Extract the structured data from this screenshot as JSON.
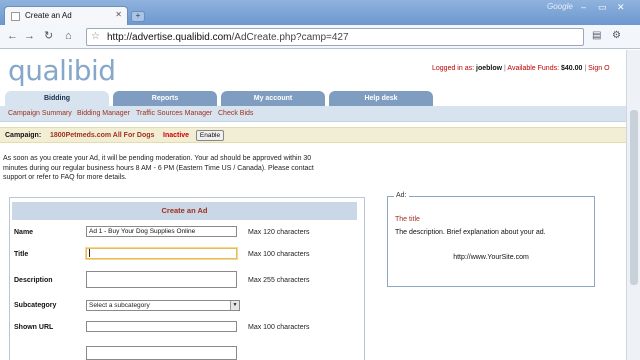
{
  "browser": {
    "tab_title": "Create an Ad",
    "new_tab": "+",
    "google_label": "Google",
    "url_host": "http://advertise.qualibid.com",
    "url_path": "/AdCreate.php?camp=427",
    "window_controls": [
      "–",
      "▭",
      "✕"
    ]
  },
  "header": {
    "logo": "qualibid",
    "logged_in_label": "Logged in as:",
    "username": "joeblow",
    "separator": "|",
    "funds_label": "Available Funds:",
    "funds_value": "$40.00",
    "sign_out": "Sign O"
  },
  "nav": {
    "tabs": [
      "Bidding",
      "Reports",
      "My account",
      "Help desk"
    ],
    "active": "Bidding",
    "subnav": [
      "Campaign Summary",
      "Bidding Manager",
      "Traffic Sources Manager",
      "Check Bids"
    ]
  },
  "campaign": {
    "label": "Campaign:",
    "name": "1800Petmeds.com All For Dogs",
    "status": "Inactive",
    "enable_button": "Enable"
  },
  "intro_text": "As soon as you create your Ad, it will be pending moderation. Your ad should be approved within 30 minutes during our regular business hours 8 AM - 6 PM (Eastern Time US / Canada). Please contact support or refer to FAQ for more details.",
  "form": {
    "heading": "Create an Ad",
    "name_label": "Name",
    "name_value": "Ad 1 - Buy Your Dog Supplies Online",
    "name_hint": "Max 120 characters",
    "title_label": "Title",
    "title_value": "",
    "title_hint": "Max 100 characters",
    "description_label": "Description",
    "description_hint": "Max 255 characters",
    "subcategory_label": "Subcategory",
    "subcategory_value": "Select a subcategory",
    "shown_url_label": "Shown URL",
    "shown_url_hint": "Max 100 characters"
  },
  "preview": {
    "legend": "Ad:",
    "title": "The title",
    "description": "The description. Brief explanation about your ad.",
    "url": "http://www.YourSite.com"
  },
  "colors": {
    "accent_red": "#a03020",
    "nav_blue": "#7f9dc0",
    "nav_light": "#d7e3ef",
    "logo_blue": "#86a7c9"
  }
}
